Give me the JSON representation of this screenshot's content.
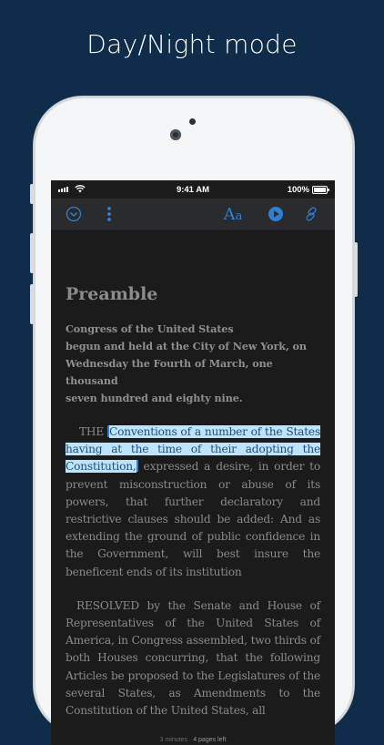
{
  "promo": {
    "title": "Day/Night mode"
  },
  "status_bar": {
    "time": "9:41 AM",
    "battery": "100%"
  },
  "toolbar": {
    "accent": "#2f7fd0",
    "icons": [
      "chevron-down-circle-icon",
      "more-vertical-icon",
      "text-size-icon",
      "play-circle-icon",
      "link-icon"
    ],
    "font_button_label": "A",
    "font_button_small": "a"
  },
  "document": {
    "title": "Preamble",
    "subhead_lines": [
      "Congress of the United States",
      "begun and held at the City of New York, on",
      "Wednesday the Fourth of March, one thousand",
      "seven hundred and eighty nine."
    ],
    "para1_lead": "THE ",
    "para1_selected": "Conventions of a number of the States having at the time of their adopting the Constitution,",
    "para1_rest": " expressed a desire, in order to prevent misconstruction or abuse of its powers, that further declaratory and restrictive clauses should be added: And as extending the ground of public confidence in the Government, will best insure the beneficent ends of its institution",
    "para2": "RESOLVED by the Senate and House of Representatives of the United States of America, in Congress assembled, two thirds of both Houses concurring, that the following Articles be proposed to the Legislatures of the several States, as Amendments to the Constitution of the United States, all"
  },
  "footer": {
    "time": "3 minutes",
    "separator": "·",
    "pages_left": "4 pages left"
  },
  "colors": {
    "background": "#0f2d4a",
    "screen": "#1b1b1c",
    "selection": "#bfe3fa"
  }
}
